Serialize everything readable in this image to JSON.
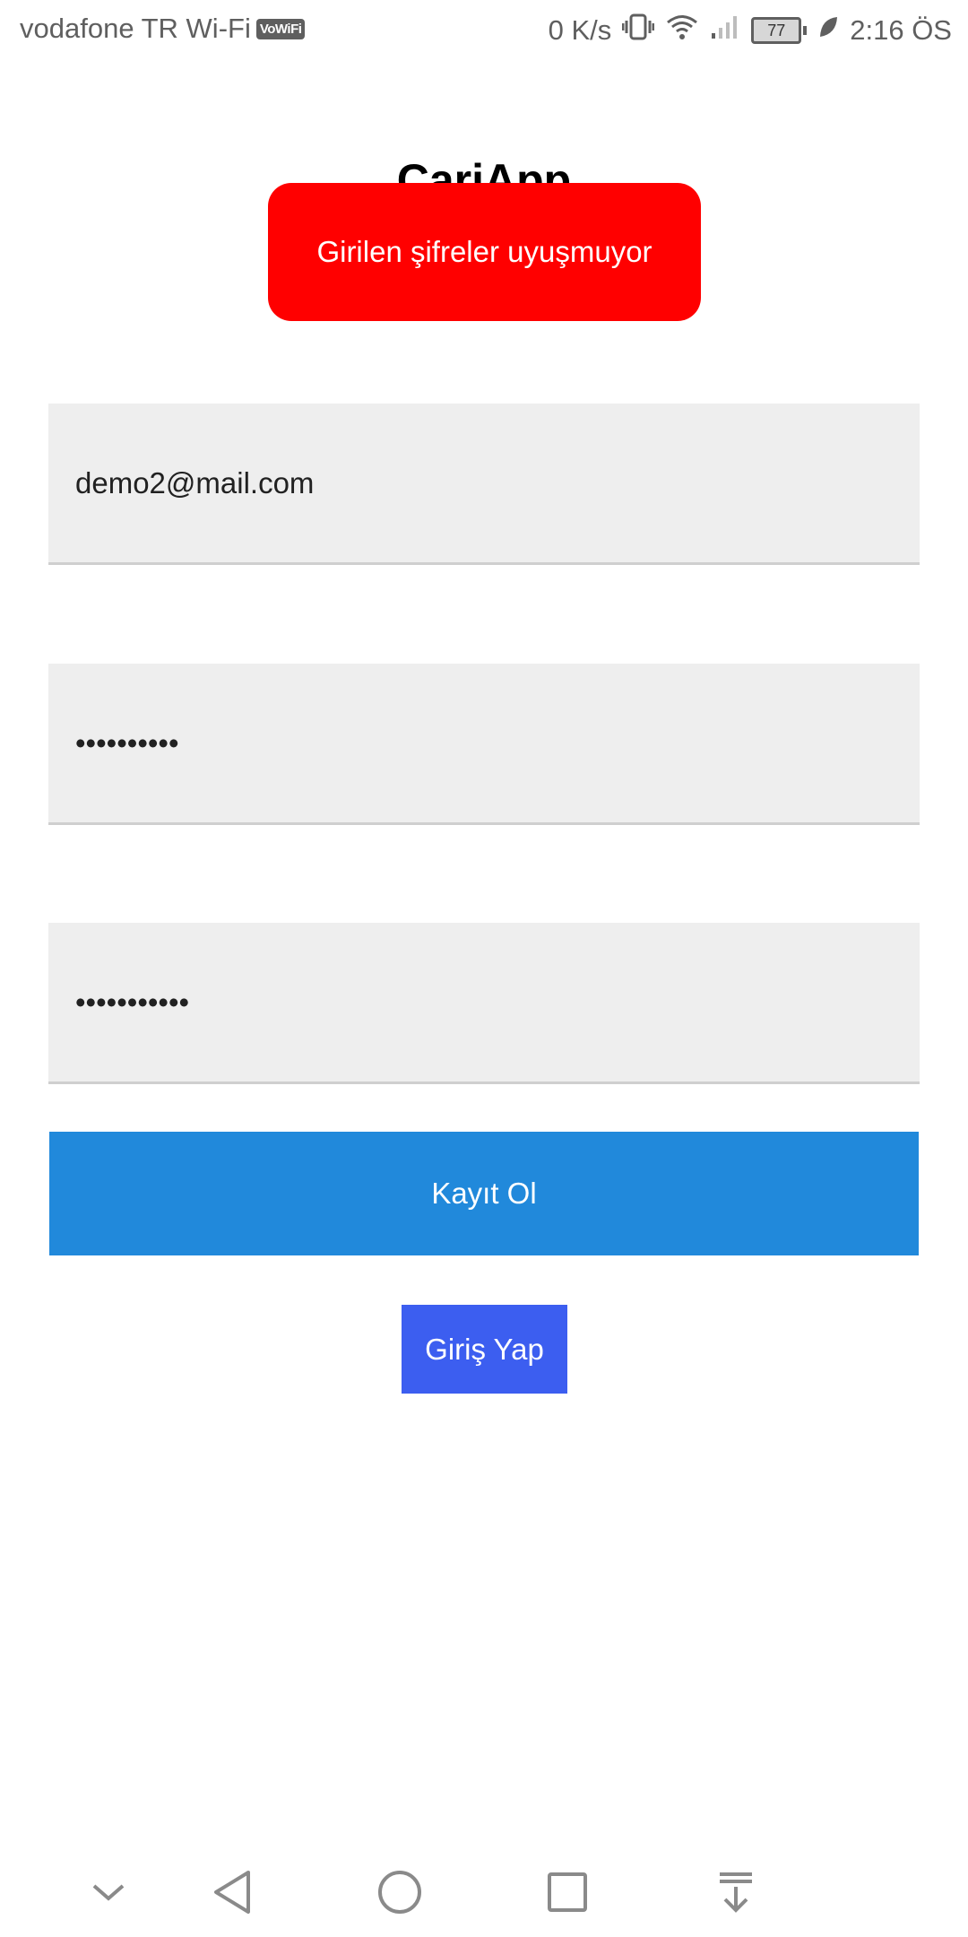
{
  "status_bar": {
    "carrier": "vodafone TR Wi-Fi",
    "vowifi_badge": "VoWiFi",
    "net_speed": "0 K/s",
    "battery_level": "77",
    "time": "2:16 ÖS"
  },
  "app": {
    "title": "CariApp"
  },
  "toast": {
    "message": "Girilen şifreler uyuşmuyor",
    "color": "#ff0000"
  },
  "form": {
    "email_value": "demo2@mail.com",
    "password_value": "••••••••••",
    "password_confirm_value": "•••••••••••"
  },
  "buttons": {
    "register_label": "Kayıt Ol",
    "register_color": "#2189db",
    "login_label": "Giriş Yap",
    "login_color": "#3c5ef0"
  },
  "nav_bar": {
    "icons": [
      "chevron-down-icon",
      "back-icon",
      "home-icon",
      "recents-icon",
      "notification-pull-icon"
    ]
  }
}
